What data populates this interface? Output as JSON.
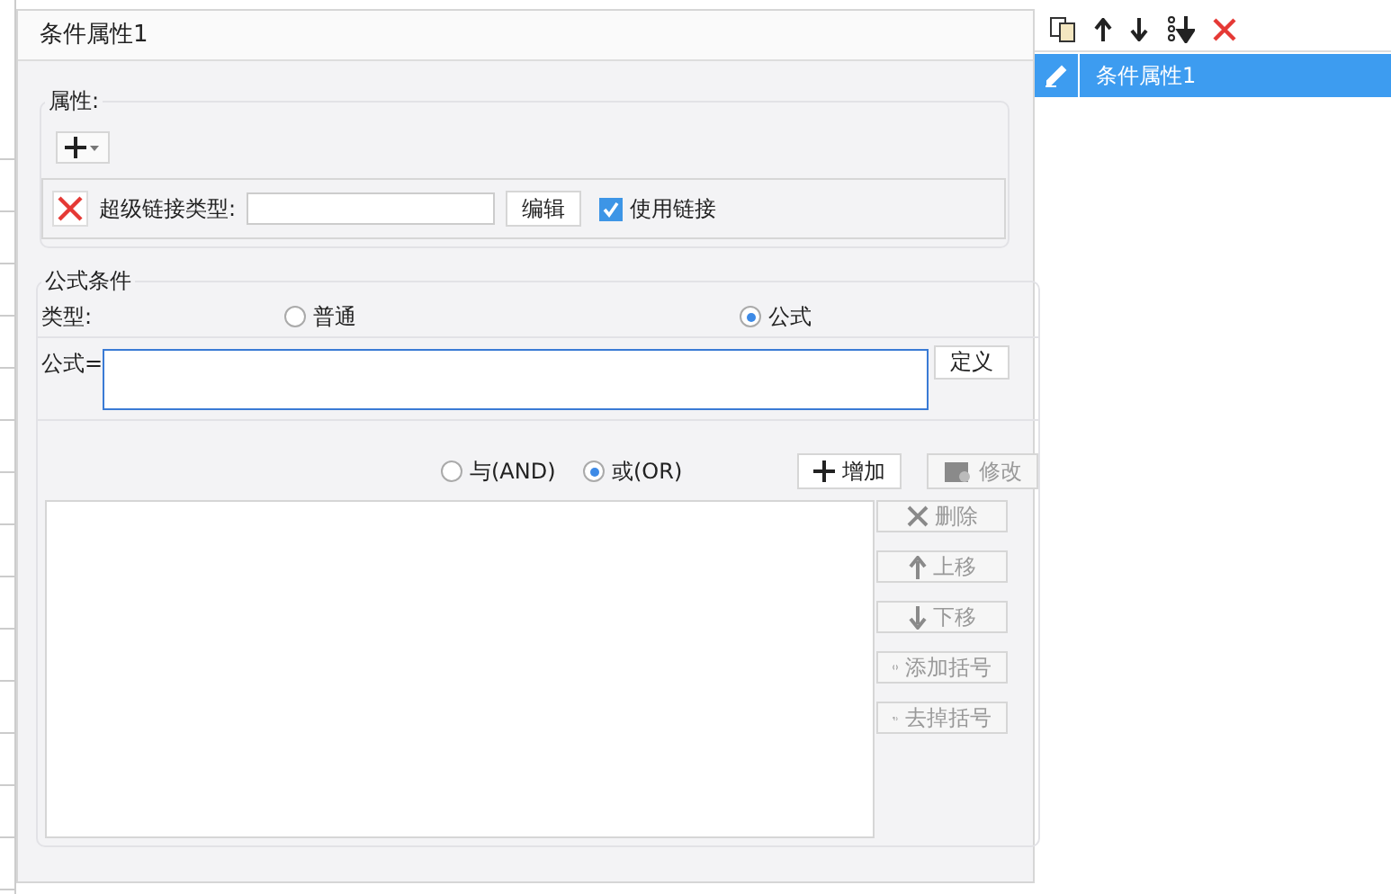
{
  "window": {
    "title": "条件属性1"
  },
  "properties": {
    "title": "属性:",
    "hyperlink_label": "超级链接类型:",
    "edit_button": "编辑",
    "use_link": {
      "label": "使用链接",
      "checked": true
    }
  },
  "formula_condition": {
    "title": "公式条件",
    "type_label": "类型:",
    "type_options": [
      {
        "label": "普通",
        "selected": false
      },
      {
        "label": "公式",
        "selected": true
      }
    ],
    "formula_label": "公式=",
    "define_button": "定义",
    "logic_options": [
      {
        "label": "与(AND)",
        "selected": false
      },
      {
        "label": "或(OR)",
        "selected": true
      }
    ],
    "top_buttons": [
      {
        "label": "增加",
        "kind": "add",
        "disabled": false
      },
      {
        "label": "修改",
        "kind": "modify",
        "disabled": true
      }
    ],
    "side_buttons": [
      {
        "label": "删除",
        "kind": "delete",
        "disabled": true
      },
      {
        "label": "上移",
        "kind": "up",
        "disabled": true
      },
      {
        "label": "下移",
        "kind": "down",
        "disabled": true
      },
      {
        "label": "添加括号",
        "kind": "paren",
        "disabled": true
      },
      {
        "label": "去掉括号",
        "kind": "unparen",
        "disabled": true
      }
    ]
  },
  "condition_list": {
    "items": [
      {
        "label": "条件属性1",
        "selected": true
      }
    ]
  }
}
